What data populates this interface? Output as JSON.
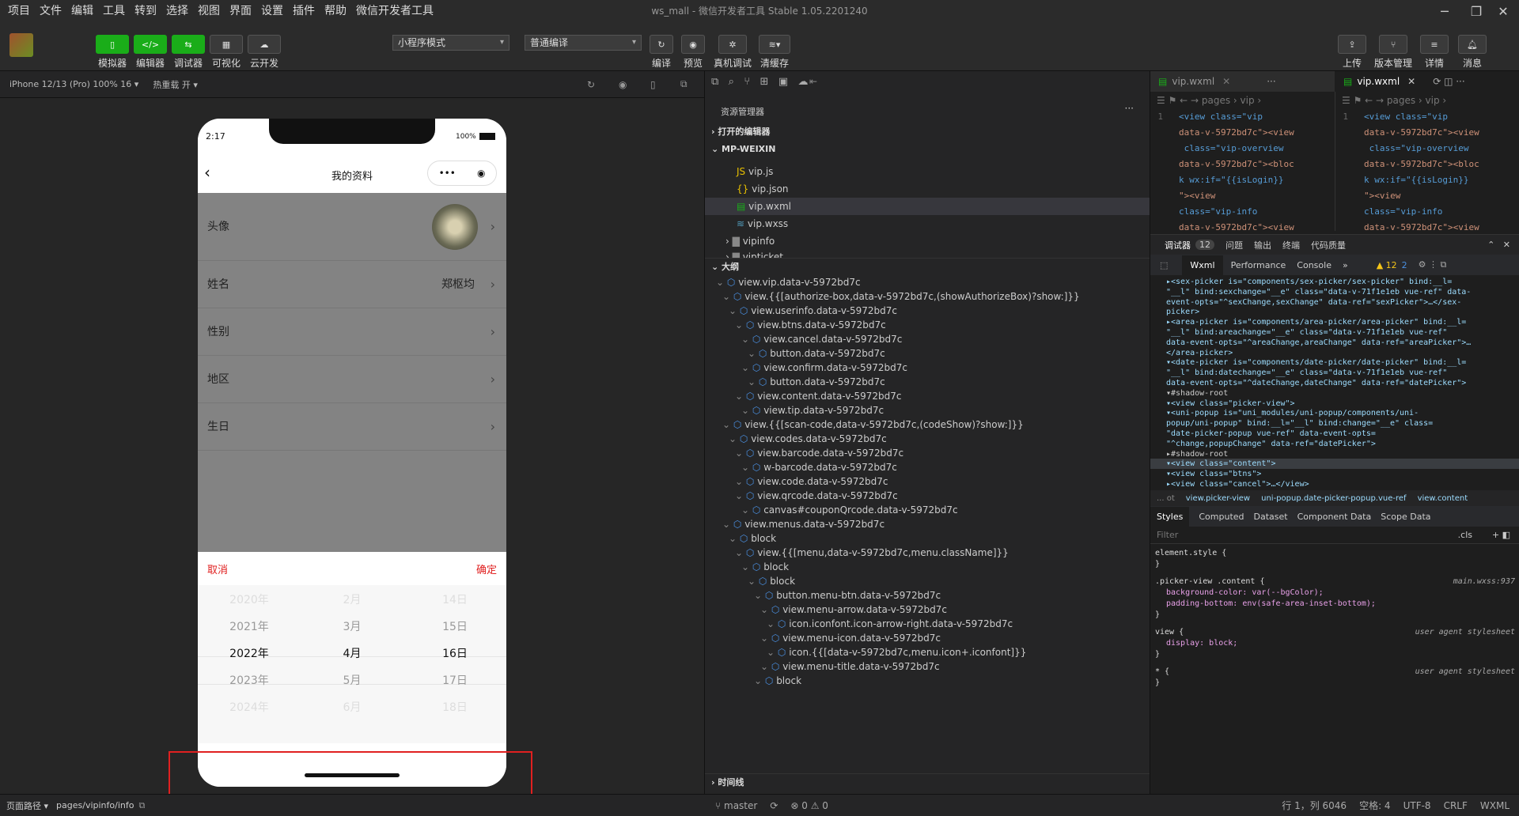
{
  "menu": [
    "项目",
    "文件",
    "编辑",
    "工具",
    "转到",
    "选择",
    "视图",
    "界面",
    "设置",
    "插件",
    "帮助",
    "微信开发者工具"
  ],
  "window_title": "ws_mall - 微信开发者工具 Stable 1.05.2201240",
  "toolbar": {
    "simulator": "模拟器",
    "editor": "编辑器",
    "debugger": "调试器",
    "visual": "可视化",
    "cloud": "云开发",
    "mode_select": "小程序模式",
    "compile_select": "普通编译",
    "compile": "编译",
    "preview": "预览",
    "real_debug": "真机调试",
    "clear_cache": "清缓存",
    "upload": "上传",
    "version": "版本管理",
    "detail": "详情",
    "message": "消息"
  },
  "simbar": {
    "device": "iPhone 12/13 (Pro) 100% 16 ▾",
    "hotreload": "热重载 开 ▾"
  },
  "phone": {
    "time": "2:17",
    "battery": "100%",
    "title": "我的资料",
    "rows": [
      {
        "label": "头像",
        "value": ""
      },
      {
        "label": "姓名",
        "value": "郑枢均"
      },
      {
        "label": "性别",
        "value": ""
      },
      {
        "label": "地区",
        "value": ""
      },
      {
        "label": "生日",
        "value": ""
      }
    ],
    "cancel": "取消",
    "confirm": "确定",
    "years": [
      "2020年",
      "2021年",
      "2022年",
      "2023年",
      "2024年"
    ],
    "months": [
      "2月",
      "3月",
      "4月",
      "5月",
      "6月"
    ],
    "days": [
      "14日",
      "15日",
      "16日",
      "17日",
      "18日"
    ]
  },
  "simstatus": {
    "path_label": "页面路径 ▾",
    "path": "pages/vipinfo/info"
  },
  "explorer": {
    "title": "资源管理器",
    "open_editors": "打开的编辑器",
    "project": "MP-WEIXIN",
    "files": [
      "vip.js",
      "vip.json",
      "vip.wxml",
      "vip.wxss",
      "vipinfo",
      "vipticket"
    ],
    "outline": "大纲",
    "timeline": "时间线"
  },
  "outline": [
    "view.vip.data-v-5972bd7c",
    "view.{{[authorize-box,data-v-5972bd7c,(showAuthorizeBox)?show:]}}",
    "view.userinfo.data-v-5972bd7c",
    "view.btns.data-v-5972bd7c",
    "view.cancel.data-v-5972bd7c",
    "button.data-v-5972bd7c",
    "view.confirm.data-v-5972bd7c",
    "button.data-v-5972bd7c",
    "view.content.data-v-5972bd7c",
    "view.tip.data-v-5972bd7c",
    "view.{{[scan-code,data-v-5972bd7c,(codeShow)?show:]}}",
    "view.codes.data-v-5972bd7c",
    "view.barcode.data-v-5972bd7c",
    "w-barcode.data-v-5972bd7c",
    "view.code.data-v-5972bd7c",
    "view.qrcode.data-v-5972bd7c",
    "canvas#couponQrcode.data-v-5972bd7c",
    "view.menus.data-v-5972bd7c",
    "block",
    "view.{{[menu,data-v-5972bd7c,menu.className]}}",
    "block",
    "block",
    "button.menu-btn.data-v-5972bd7c",
    "view.menu-arrow.data-v-5972bd7c",
    "icon.iconfont.icon-arrow-right.data-v-5972bd7c",
    "view.menu-icon.data-v-5972bd7c",
    "icon.{{[data-v-5972bd7c,menu.icon+.iconfont]}}",
    "view.menu-title.data-v-5972bd7c",
    "block"
  ],
  "editor_tabs": {
    "left": "vip.wxml",
    "right": "vip.wxml",
    "breadcrumb": "pages › vip ›"
  },
  "code_lines": [
    "<view class=\"vip",
    "data-v-5972bd7c\"><view",
    " class=\"vip-overview",
    "data-v-5972bd7c\"><bloc",
    "k wx:if=\"{{isLogin}}",
    "\"><view",
    "class=\"vip-info",
    "data-v-5972bd7c\"><view"
  ],
  "devtools": {
    "tabs": [
      "调试器",
      "12",
      "问题",
      "输出",
      "终端",
      "代码质量"
    ],
    "subtabs": [
      "Wxml",
      "Performance",
      "Console",
      "»"
    ],
    "warn": "▲ 12",
    "info": "2",
    "breadcrumb": [
      "... ot",
      "view.picker-view",
      "uni-popup.date-picker-popup.vue-ref",
      "view.content"
    ],
    "style_tabs": [
      "Styles",
      "Computed",
      "Dataset",
      "Component Data",
      "Scope Data"
    ],
    "filter": "Filter",
    "cls": ".cls"
  },
  "dom_lines": [
    "▸<sex-picker is=\"components/sex-picker/sex-picker\" bind:__l=",
    "\"__l\" bind:sexchange=\"__e\" class=\"data-v-71f1e1eb vue-ref\" data-",
    "event-opts=\"^sexChange,sexChange\" data-ref=\"sexPicker\">…</sex-",
    "picker>",
    "▸<area-picker is=\"components/area-picker/area-picker\" bind:__l=",
    "\"__l\" bind:areachange=\"__e\" class=\"data-v-71f1e1eb vue-ref\"",
    "data-event-opts=\"^areaChange,areaChange\" data-ref=\"areaPicker\">…",
    "</area-picker>",
    "▾<date-picker is=\"components/date-picker/date-picker\" bind:__l=",
    "\"__l\" bind:datechange=\"__e\" class=\"data-v-71f1e1eb vue-ref\"",
    "data-event-opts=\"^dateChange,dateChange\" data-ref=\"datePicker\">",
    "  ▾#shadow-root",
    "    ▾<view class=\"picker-view\">",
    "      ▾<uni-popup is=\"uni_modules/uni-popup/components/uni-",
    "      popup/uni-popup\" bind:__l=\"__l\" bind:change=\"__e\" class=",
    "      \"date-picker-popup vue-ref\" data-event-opts=",
    "      \"^change,popupChange\" data-ref=\"datePicker\">",
    "        ▸#shadow-root",
    "        ▾<view class=\"content\">",
    "          ▾<view class=\"btns\">",
    "            ▸<view class=\"cancel\">…</view>"
  ],
  "styles": [
    {
      "sel": "element.style {",
      "src": ""
    },
    {
      "sel": ".picker-view .content {",
      "src": "main.wxss:937",
      "props": [
        "background-color: var(--bgColor);",
        "padding-bottom: env(safe-area-inset-bottom);"
      ]
    },
    {
      "sel": "view {",
      "src": "user agent stylesheet",
      "props": [
        "display: block;"
      ]
    },
    {
      "sel": "* {",
      "src": "user agent stylesheet"
    }
  ],
  "statusbar": {
    "branch": "master",
    "errors": "⊗ 0 ⚠ 0",
    "pos": "行 1，列 6046",
    "spaces": "空格: 4",
    "enc": "UTF-8",
    "eol": "CRLF",
    "lang": "WXML"
  },
  "colors": {
    "accent": "#1aad19",
    "red_box": "#e02020",
    "cancel": "#e02020"
  }
}
